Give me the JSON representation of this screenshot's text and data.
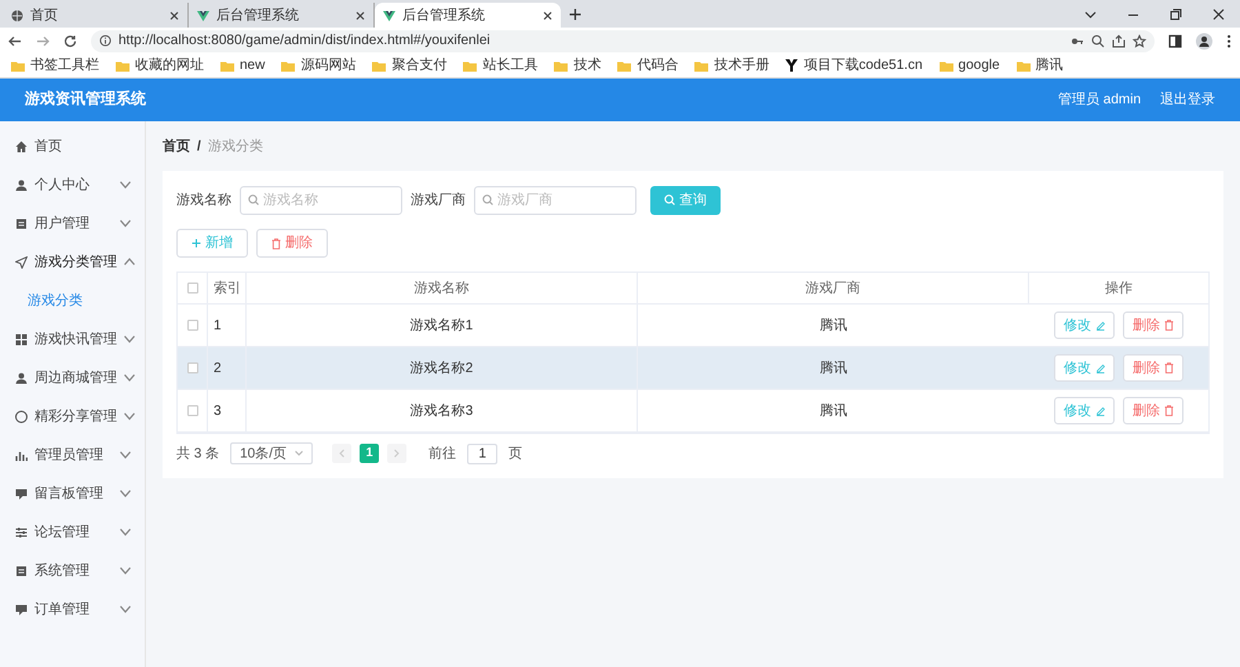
{
  "browser": {
    "tabs": [
      {
        "title": "首页",
        "kind": "globe",
        "selected": false
      },
      {
        "title": "后台管理系统",
        "kind": "vue",
        "selected": false
      },
      {
        "title": "后台管理系统",
        "kind": "vue",
        "selected": true
      }
    ],
    "url": "http://localhost:8080/game/admin/dist/index.html#/youxifenlei",
    "bookmarks": [
      {
        "label": "书签工具栏",
        "kind": "folder"
      },
      {
        "label": "收藏的网址",
        "kind": "folder"
      },
      {
        "label": "new",
        "kind": "folder"
      },
      {
        "label": "源码网站",
        "kind": "folder"
      },
      {
        "label": "聚合支付",
        "kind": "folder"
      },
      {
        "label": "站长工具",
        "kind": "folder"
      },
      {
        "label": "技术",
        "kind": "folder"
      },
      {
        "label": "代码合",
        "kind": "folder"
      },
      {
        "label": "技术手册",
        "kind": "folder"
      },
      {
        "label": "项目下载code51.cn",
        "kind": "site"
      },
      {
        "label": "google",
        "kind": "folder"
      },
      {
        "label": "腾讯",
        "kind": "folder"
      }
    ]
  },
  "header": {
    "title": "游戏资讯管理系统",
    "user": "管理员 admin",
    "logout": "退出登录"
  },
  "sidebar": {
    "items": [
      {
        "label": "首页"
      },
      {
        "label": "个人中心",
        "expanded": false
      },
      {
        "label": "用户管理",
        "expanded": false
      },
      {
        "label": "游戏分类管理",
        "expanded": true,
        "children": [
          {
            "label": "游戏分类",
            "selected": true
          }
        ]
      },
      {
        "label": "游戏快讯管理",
        "expanded": false
      },
      {
        "label": "周边商城管理",
        "expanded": false
      },
      {
        "label": "精彩分享管理",
        "expanded": false
      },
      {
        "label": "管理员管理",
        "expanded": false
      },
      {
        "label": "留言板管理",
        "expanded": false
      },
      {
        "label": "论坛管理",
        "expanded": false
      },
      {
        "label": "系统管理",
        "expanded": false
      },
      {
        "label": "订单管理",
        "expanded": false
      }
    ]
  },
  "breadcrumb": {
    "items": [
      "首页",
      "游戏分类"
    ],
    "separator": "/"
  },
  "search": {
    "fields": [
      {
        "label": "游戏名称",
        "placeholder": "游戏名称"
      },
      {
        "label": "游戏厂商",
        "placeholder": "游戏厂商"
      }
    ],
    "button": "查询"
  },
  "actions": [
    {
      "label": "新增",
      "kind": "add"
    },
    {
      "label": "删除",
      "kind": "delete"
    }
  ],
  "table": {
    "all_checked": false,
    "columns": [
      "索引",
      "游戏名称",
      "游戏厂商",
      "操作"
    ],
    "rows": [
      {
        "index": "1",
        "name": "游戏名称1",
        "vendor": "腾讯",
        "checked": false,
        "selected": false,
        "edit": "修改",
        "delete": "删除"
      },
      {
        "index": "2",
        "name": "游戏名称2",
        "vendor": "腾讯",
        "checked": false,
        "selected": true,
        "edit": "修改",
        "delete": "删除"
      },
      {
        "index": "3",
        "name": "游戏名称3",
        "vendor": "腾讯",
        "checked": false,
        "selected": false,
        "edit": "修改",
        "delete": "删除"
      }
    ]
  },
  "pagination": {
    "total": "共 3 条",
    "page_size": "10条/页",
    "pages": [
      {
        "label": "1",
        "selected": true
      }
    ],
    "goto": "前往",
    "goto_value": "1",
    "goto_suffix": "页"
  }
}
